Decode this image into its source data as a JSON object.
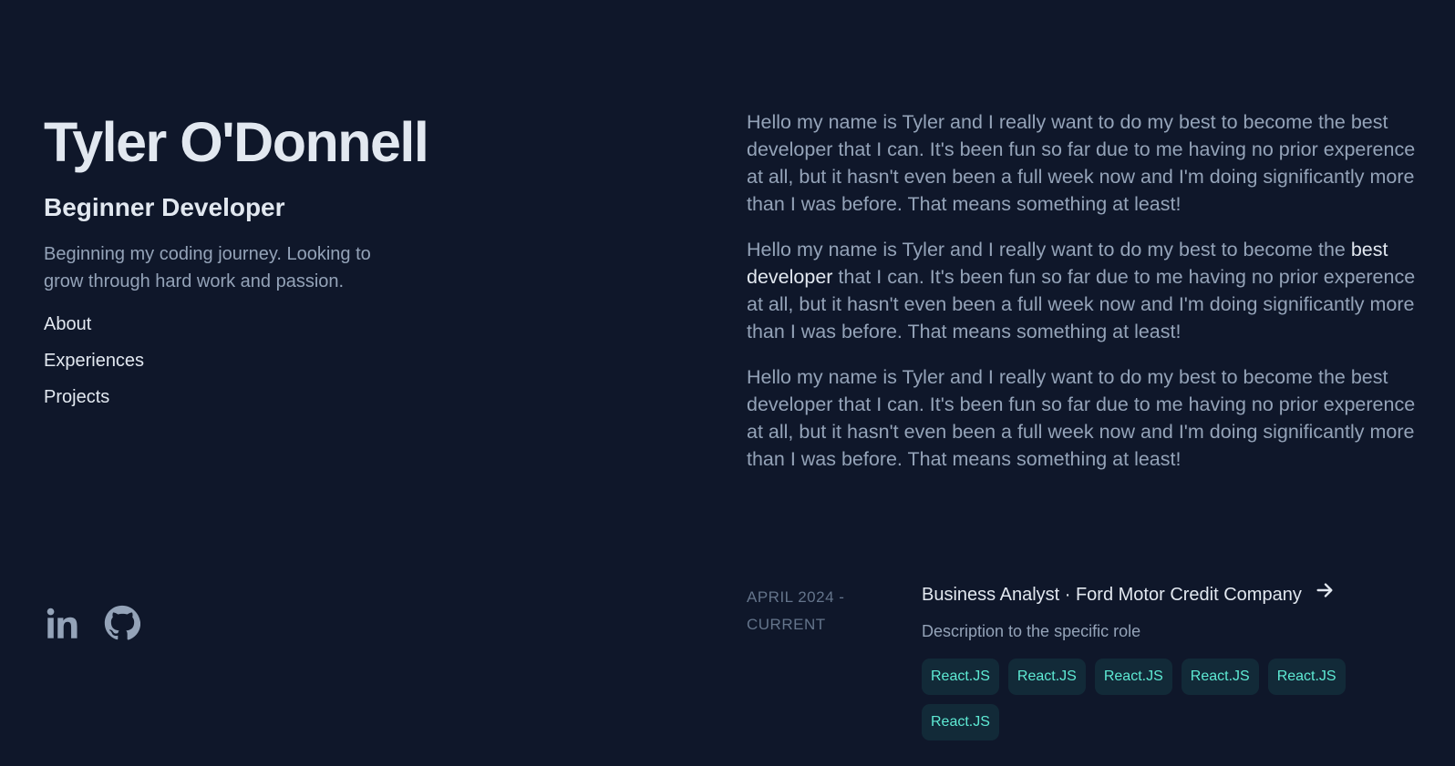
{
  "header": {
    "name": "Tyler O'Donnell",
    "role": "Beginner Developer",
    "tagline": "Beginning my coding journey. Looking to grow through hard work and passion."
  },
  "nav": {
    "items": [
      {
        "label": "About"
      },
      {
        "label": "Experiences"
      },
      {
        "label": "Projects"
      }
    ]
  },
  "socials": {
    "items": [
      {
        "icon": "linkedin-icon"
      },
      {
        "icon": "github-icon"
      }
    ]
  },
  "about": {
    "paragraphs": [
      {
        "before": "Hello my name is Tyler and I really want to do my best to become the best developer that I can. It's been fun so far due to me having no prior experence at all, but it hasn't even been a full week now and I'm doing significantly more than I was before. That means something at least!",
        "highlight": "",
        "after": ""
      },
      {
        "before": "Hello my name is Tyler and I really want to do my best to become the ",
        "highlight": "best developer",
        "after": " that I can. It's been fun so far due to me having no prior experence at all, but it hasn't even been a full week now and I'm doing significantly more than I was before. That means something at least!"
      },
      {
        "before": "Hello my name is Tyler and I really want to do my best to become the best developer that I can. It's been fun so far due to me having no prior experence at all, but it hasn't even been a full week now and I'm doing significantly more than I was before. That means something at least!",
        "highlight": "",
        "after": ""
      }
    ]
  },
  "experience": {
    "date": "APRIL 2024 - CURRENT",
    "title": "Business Analyst · Ford Motor Credit Company",
    "description": "Description to the specific role",
    "tags": [
      "React.JS",
      "React.JS",
      "React.JS",
      "React.JS",
      "React.JS",
      "React.JS"
    ]
  },
  "colors": {
    "background": "#0f172a",
    "heading": "#e2e8f0",
    "body_text": "#94a3b8",
    "muted": "#64748b",
    "accent": "#5eead4"
  }
}
